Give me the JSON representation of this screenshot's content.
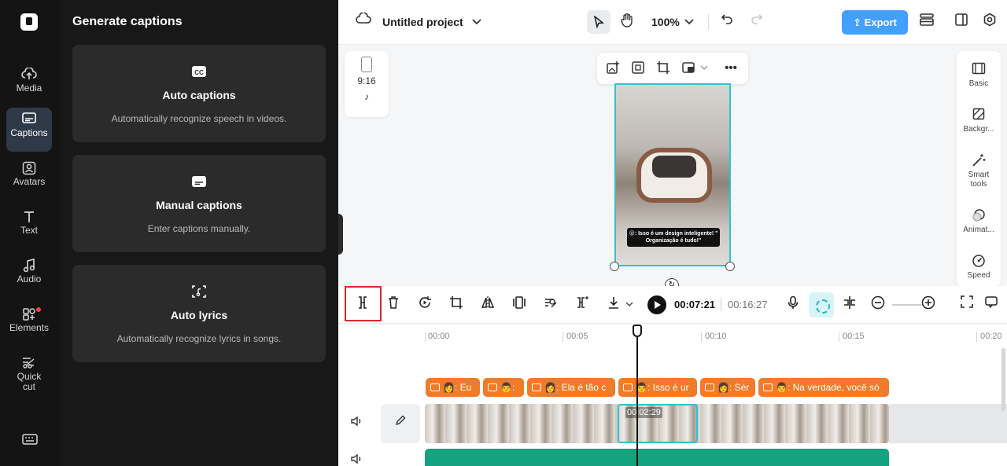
{
  "rail": {
    "items": [
      {
        "label": "Media",
        "icon": "cloud-upload-icon"
      },
      {
        "label": "Captions",
        "icon": "captions-icon",
        "active": true
      },
      {
        "label": "Avatars",
        "icon": "avatar-icon"
      },
      {
        "label": "Text",
        "icon": "text-icon"
      },
      {
        "label": "Audio",
        "icon": "music-note-icon"
      },
      {
        "label": "Elements",
        "icon": "elements-icon",
        "badge_color": "#ff3b4a"
      },
      {
        "label": "Quick\ncut",
        "icon": "quick-cut-icon"
      }
    ],
    "keyboard_icon": "keyboard-icon"
  },
  "panel": {
    "title": "Generate captions",
    "cards": [
      {
        "title": "Auto captions",
        "description": "Automatically recognize speech in videos.",
        "icon": "cc-icon"
      },
      {
        "title": "Manual captions",
        "description": "Enter captions manually.",
        "icon": "subtitle-icon"
      },
      {
        "title": "Auto lyrics",
        "description": "Automatically recognize lyrics in songs.",
        "icon": "lyrics-scan-icon"
      }
    ]
  },
  "topbar": {
    "project_title": "Untitled project",
    "zoom": "100%",
    "export_label": "Export",
    "accent_color": "#43a0ff"
  },
  "canvas": {
    "ratio_label": "9:16",
    "preview_caption": "😮: Isso é um design inteligente! \" Organização é tudo!\""
  },
  "right_sidebar": {
    "items": [
      {
        "label": "Basic",
        "icon": "basic-icon"
      },
      {
        "label": "Backgr...",
        "icon": "background-icon"
      },
      {
        "label": "Smart tools",
        "icon": "magic-wand-icon"
      },
      {
        "label": "Animat...",
        "icon": "animation-icon"
      },
      {
        "label": "Speed",
        "icon": "speed-icon"
      }
    ]
  },
  "timeline_toolbar": {
    "current_time": "00:07:21",
    "total_time": "00:16:27"
  },
  "timeline": {
    "ruler": [
      "00:00",
      "00:05",
      "00:10",
      "00:15",
      "00:20"
    ],
    "caption_clips": [
      "👩: Eu",
      "👨:",
      "👩: Ela é tão c",
      "👨: Isso é ur",
      "👩: Sér",
      "👨: Na verdade, você só"
    ],
    "selected_clip_duration": "00:02:29"
  }
}
